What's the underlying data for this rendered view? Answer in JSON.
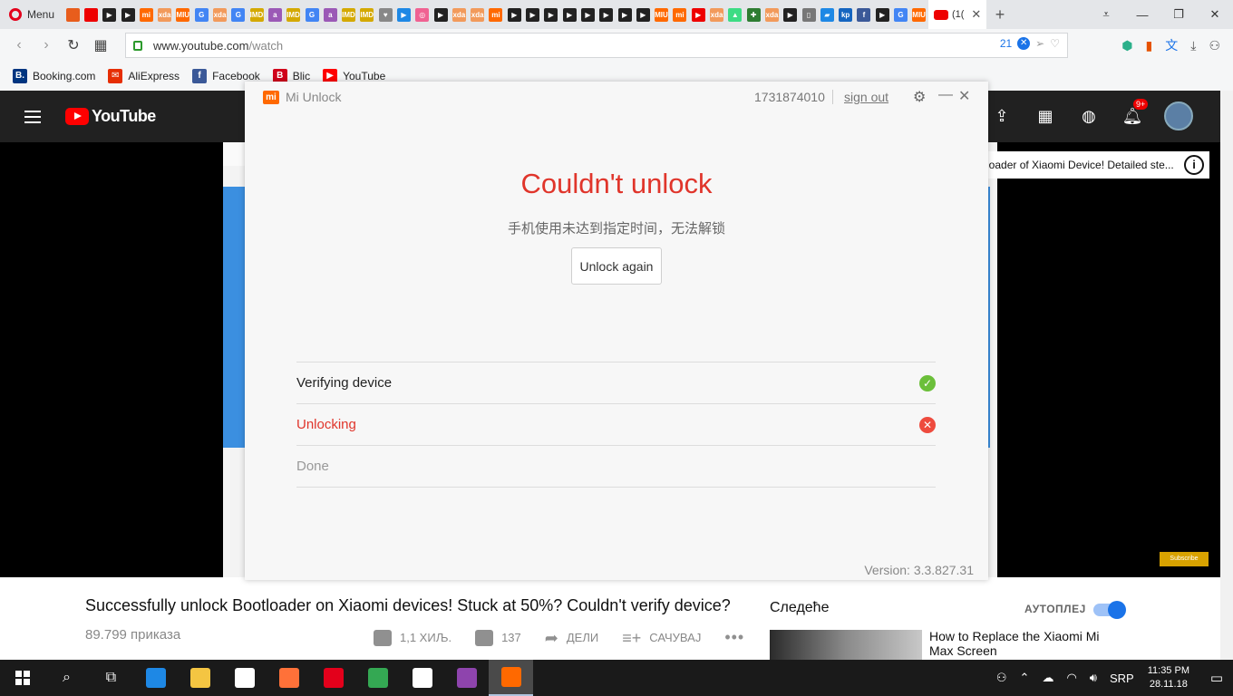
{
  "browser": {
    "menu_label": "Menu",
    "active_tab_label": "(1(",
    "tab_icons": [
      {
        "name": "opera-addons-icon",
        "color": "#e85d1c",
        "t": ""
      },
      {
        "name": "youtube-tab-icon",
        "color": "#e00",
        "t": ""
      },
      {
        "name": "play-tab-icon",
        "color": "#222",
        "t": "▶"
      },
      {
        "name": "play-tab-icon",
        "color": "#222",
        "t": "▶"
      },
      {
        "name": "mi-tab-icon",
        "color": "#ff6900",
        "t": "mi"
      },
      {
        "name": "xda-tab-icon",
        "color": "#f29a5b",
        "t": "xda"
      },
      {
        "name": "miui-tab-icon",
        "color": "#ff6900",
        "t": "MIUI"
      },
      {
        "name": "google-tab-icon",
        "color": "#4285f4",
        "t": "G"
      },
      {
        "name": "xda-tab-icon",
        "color": "#f29a5b",
        "t": "xda"
      },
      {
        "name": "google-tab-icon",
        "color": "#4285f4",
        "t": "G"
      },
      {
        "name": "imdb-tab-icon",
        "color": "#d4a900",
        "t": "IMDb"
      },
      {
        "name": "amazon-tab-icon",
        "color": "#9b59b6",
        "t": "a"
      },
      {
        "name": "imdb-tab-icon",
        "color": "#d4a900",
        "t": "IMDb"
      },
      {
        "name": "google-tab-icon",
        "color": "#4285f4",
        "t": "G"
      },
      {
        "name": "amazon-tab-icon",
        "color": "#9b59b6",
        "t": "a"
      },
      {
        "name": "imdb-tab-icon",
        "color": "#d4a900",
        "t": "IMDb"
      },
      {
        "name": "imdb-tab-icon",
        "color": "#d4a900",
        "t": "IMDb"
      },
      {
        "name": "heart-tab-icon",
        "color": "#888",
        "t": "♥"
      },
      {
        "name": "play-tab-icon",
        "color": "#1e88e5",
        "t": "▶"
      },
      {
        "name": "circle-tab-icon",
        "color": "#f06292",
        "t": "◎"
      },
      {
        "name": "play-tab-icon",
        "color": "#222",
        "t": "▶"
      },
      {
        "name": "xda-tab-icon",
        "color": "#f29a5b",
        "t": "xda"
      },
      {
        "name": "xda-tab-icon",
        "color": "#f29a5b",
        "t": "xda"
      },
      {
        "name": "mi-tab-icon",
        "color": "#ff6900",
        "t": "mi"
      },
      {
        "name": "play-tab-icon",
        "color": "#222",
        "t": "▶"
      },
      {
        "name": "play-tab-icon",
        "color": "#222",
        "t": "▶"
      },
      {
        "name": "play-tab-icon",
        "color": "#222",
        "t": "▶"
      },
      {
        "name": "play-tab-icon",
        "color": "#222",
        "t": "▶"
      },
      {
        "name": "play-tab-icon",
        "color": "#222",
        "t": "▶"
      },
      {
        "name": "play-tab-icon",
        "color": "#222",
        "t": "▶"
      },
      {
        "name": "play-tab-icon",
        "color": "#222",
        "t": "▶"
      },
      {
        "name": "play-tab-icon",
        "color": "#222",
        "t": "▶"
      },
      {
        "name": "miui-tab-icon",
        "color": "#ff6900",
        "t": "MIUI"
      },
      {
        "name": "mi-tab-icon",
        "color": "#ff6900",
        "t": "mi"
      },
      {
        "name": "youtube-tab-icon",
        "color": "#e00",
        "t": "▶"
      },
      {
        "name": "xda-tab-icon",
        "color": "#f29a5b",
        "t": "xda"
      },
      {
        "name": "android-tab-icon",
        "color": "#3ddc84",
        "t": "▲"
      },
      {
        "name": "android-tab-icon",
        "color": "#2e7d32",
        "t": "✚"
      },
      {
        "name": "xda-tab-icon",
        "color": "#f29a5b",
        "t": "xda"
      },
      {
        "name": "play-tab-icon",
        "color": "#222",
        "t": "▶"
      },
      {
        "name": "doc-tab-icon",
        "color": "#777",
        "t": "▯"
      },
      {
        "name": "drive-tab-icon",
        "color": "#1e88e5",
        "t": "▰"
      },
      {
        "name": "kp-tab-icon",
        "color": "#1565c0",
        "t": "kp"
      },
      {
        "name": "facebook-tab-icon",
        "color": "#3b5998",
        "t": "f"
      },
      {
        "name": "play-tab-icon",
        "color": "#222",
        "t": "▶"
      },
      {
        "name": "google-tab-icon",
        "color": "#4285f4",
        "t": "G"
      },
      {
        "name": "miui-tab-icon",
        "color": "#ff6900",
        "t": "MIUI"
      }
    ],
    "url_host": "www.youtube.com",
    "url_path": "/watch",
    "blocked_count": "21",
    "bookmarks": [
      {
        "label": "Booking.com",
        "color": "#003580",
        "glyph": "B."
      },
      {
        "label": "AliExpress",
        "color": "#e62e04",
        "glyph": "✉"
      },
      {
        "label": "Facebook",
        "color": "#3b5998",
        "glyph": "f"
      },
      {
        "label": "Blic",
        "color": "#d0021b",
        "glyph": "B"
      },
      {
        "label": "YouTube",
        "color": "#ff0000",
        "glyph": "▶"
      }
    ]
  },
  "youtube": {
    "logo_text": "YouTube",
    "notif_count": "9+",
    "overlay_title": "loader of Xiaomi Device! Detailed ste...",
    "subscribe_watermark": "Subscribe",
    "video_title": "Successfully unlock Bootloader on Xiaomi devices! Stuck at 50%? Couldn't verify device?",
    "views": "89.799 приказа",
    "likes": "1,1 ХИЉ.",
    "dislikes": "137",
    "share_label": "ДЕЛИ",
    "save_label": "САЧУВАЈ",
    "next_label": "Следеће",
    "autoplay_label": "АУТОПЛЕЈ",
    "autoplay_on": true,
    "rec_title": "How to Replace the Xiaomi Mi Max Screen"
  },
  "mi_unlock": {
    "app_title": "Mi Unlock",
    "account_id": "1731874010",
    "sign_out": "sign out",
    "heading": "Couldn't unlock",
    "subtitle": "手机使用未达到指定时间，无法解锁",
    "button_label": "Unlock again",
    "steps": [
      {
        "label": "Verifying device",
        "status": "success"
      },
      {
        "label": "Unlocking",
        "status": "failed"
      },
      {
        "label": "Done",
        "status": "pending"
      }
    ],
    "version": "Version: 3.3.827.31",
    "accent_color": "#e0352b"
  },
  "taskbar": {
    "apps": [
      {
        "name": "edge-app-icon",
        "color": "#1e88e5"
      },
      {
        "name": "file-explorer-icon",
        "color": "#f4c542"
      },
      {
        "name": "store-app-icon",
        "color": "#ffffff"
      },
      {
        "name": "firefox-app-icon",
        "color": "#ff7139"
      },
      {
        "name": "opera-app-icon",
        "color": "#e3001b"
      },
      {
        "name": "chrome-app-icon",
        "color": "#34a853"
      },
      {
        "name": "mail-app-icon",
        "color": "#ffffff"
      },
      {
        "name": "winrar-app-icon",
        "color": "#8e44ad"
      },
      {
        "name": "mi-unlock-app-icon",
        "color": "#ff6900"
      }
    ],
    "language": "SRP",
    "time": "11:35 PM",
    "date": "28.11.18"
  }
}
